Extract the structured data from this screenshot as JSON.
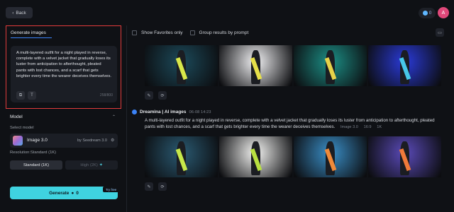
{
  "topbar": {
    "back_label": "Back",
    "credits_value": "0",
    "avatar_initial": "A"
  },
  "generate_panel": {
    "title": "Generate images",
    "prompt": "A multi-layered outfit for a night played in reverse, complete with a velvet jacket that gradually loses its luster from anticipation to afterthought, pleated pants with lost chances, and a scarf that gets brighter every time the wearer deceives themselves.",
    "char_count": "258/800"
  },
  "model_section": {
    "title": "Model",
    "select_label": "Select model",
    "model_name": "Image 3.0",
    "model_provider": "by Seedream 3.0",
    "resolution_label": "Resolution:Standard (1K)",
    "standard_label": "Standard (1K)",
    "high_label": "High (2K)"
  },
  "generate_button": {
    "label": "Generate",
    "cost": "0",
    "badge": "Try free"
  },
  "filters": {
    "favorites_label": "Show Favorites only",
    "group_label": "Group results by prompt"
  },
  "entry": {
    "source": "Dreamina | AI images",
    "time": "06-08  14:23",
    "prompt": "A multi-layered outfit for a night played in reverse, complete with a velvet jacket that gradually loses its luster from anticipation to afterthought, pleated pants with lost chances, and a scarf that gets brighter every time the wearer deceives themselves.",
    "meta_model": "Image 3.0",
    "meta_ratio": "16:9",
    "meta_res": "1K"
  },
  "images_row1": [
    {
      "name": "generated-image-1",
      "bg": "#1c4a5a",
      "scarf": "#d8e84a"
    },
    {
      "name": "generated-image-2",
      "bg": "#f2f2f4",
      "scarf": "#e6e04a"
    },
    {
      "name": "generated-image-3",
      "bg": "#1c8f86",
      "scarf": "#e6d24a"
    },
    {
      "name": "generated-image-4",
      "bg": "#2a3ad8",
      "scarf": "#47c8e8"
    }
  ],
  "images_row2": [
    {
      "name": "generated-image-5",
      "bg": "#2a5a72",
      "scarf": "#c6e84a"
    },
    {
      "name": "generated-image-6",
      "bg": "#f4f4f2",
      "scarf": "#b8e040"
    },
    {
      "name": "generated-image-7",
      "bg": "#3a8fc8",
      "scarf": "#f08a3a"
    },
    {
      "name": "generated-image-8",
      "bg": "#5a4ab8",
      "scarf": "#f07a3a"
    }
  ]
}
